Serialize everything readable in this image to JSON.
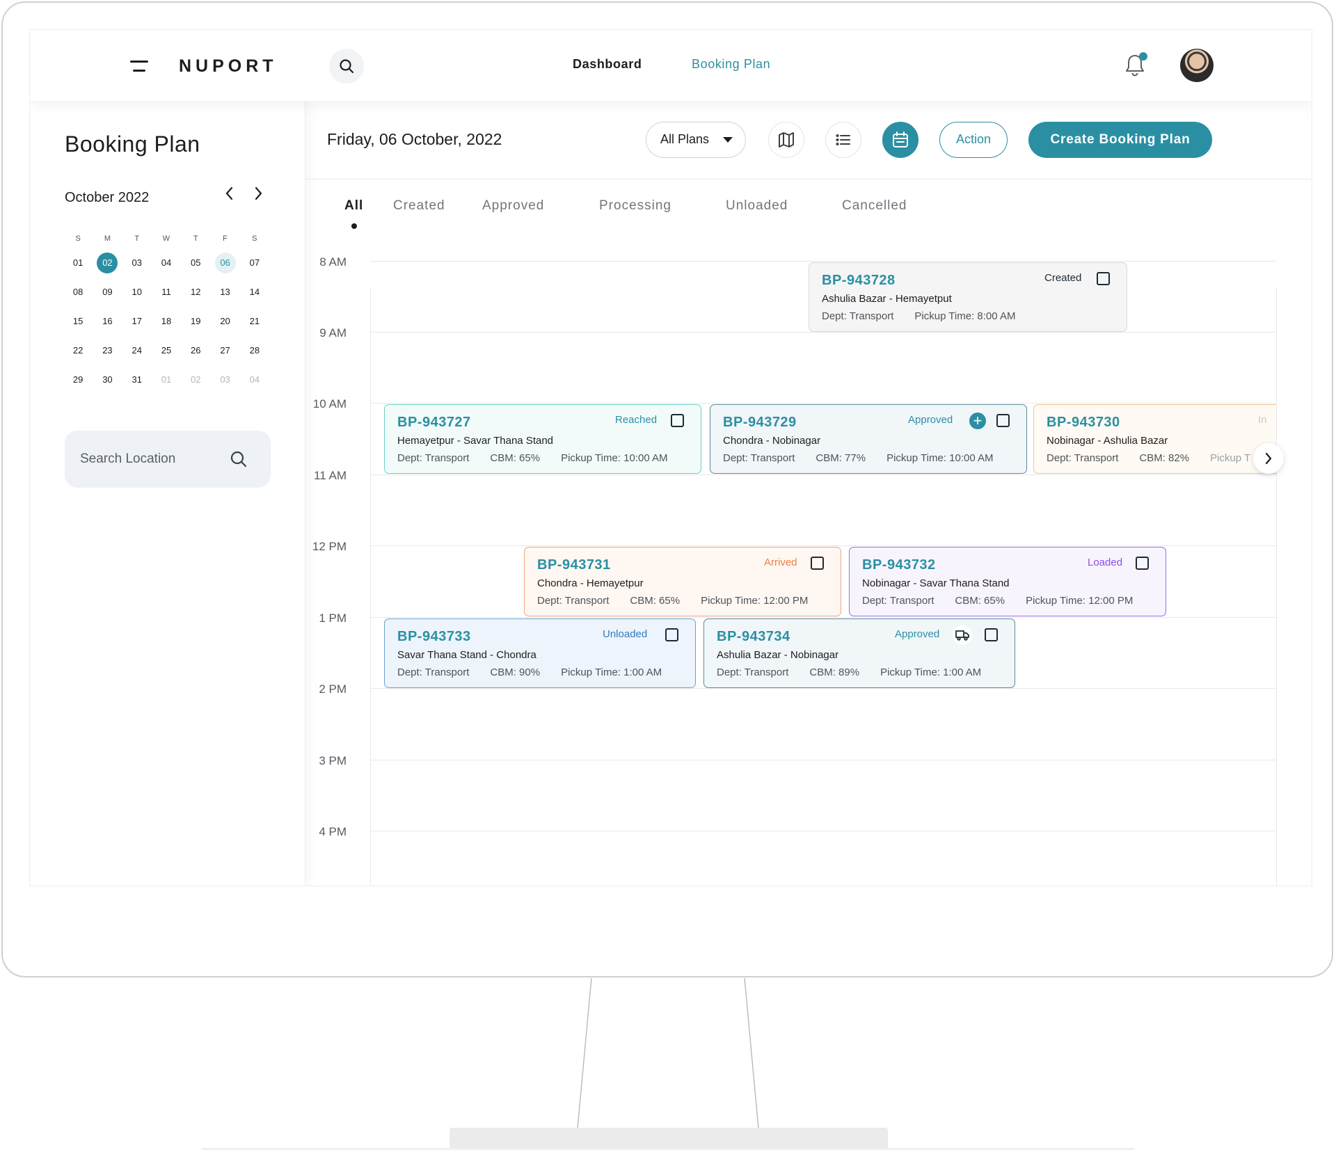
{
  "app": {
    "logo": "NUPORT"
  },
  "nav": {
    "dashboard": "Dashboard",
    "booking_plan": "Booking Plan"
  },
  "sidebar": {
    "title": "Booking Plan",
    "calendar": {
      "month": "October 2022",
      "weekdays": [
        "S",
        "M",
        "T",
        "W",
        "T",
        "F",
        "S"
      ],
      "weeks": [
        [
          "01",
          "02",
          "03",
          "04",
          "05",
          "06",
          "07"
        ],
        [
          "08",
          "09",
          "10",
          "11",
          "12",
          "13",
          "14"
        ],
        [
          "15",
          "16",
          "17",
          "18",
          "19",
          "20",
          "21"
        ],
        [
          "22",
          "23",
          "24",
          "25",
          "26",
          "27",
          "28"
        ],
        [
          "29",
          "30",
          "31",
          "01",
          "02",
          "03",
          "04"
        ]
      ],
      "selected_day": "02",
      "highlighted_day": "06"
    },
    "search_placeholder": "Search Location"
  },
  "toolbar": {
    "date": "Friday, 06 October, 2022",
    "plans_filter": "All Plans",
    "action_label": "Action",
    "create_label": "Create Booking Plan"
  },
  "tabs": [
    "All",
    "Created",
    "Approved",
    "Processing",
    "Unloaded",
    "Cancelled"
  ],
  "active_tab": "All",
  "hours": [
    "8 AM",
    "9 AM",
    "10 AM",
    "11 AM",
    "12 PM",
    "1 PM",
    "2 PM",
    "3 PM",
    "4 PM"
  ],
  "colors": {
    "accent": "#2b8fa3",
    "created": "#1d2a33",
    "reached": "#2b8fa3",
    "approved": "#2b8fa3",
    "arrived": "#ef7f45",
    "loaded": "#8a4de8",
    "unloaded": "#2f7bc2"
  },
  "cards": [
    {
      "id": "BP-943728",
      "status": "Created",
      "route": "Ashulia Bazar - Hemayetput",
      "dept": "Dept: Transport",
      "cbm": "",
      "pickup": "Pickup Time: 8:00 AM"
    },
    {
      "id": "BP-943727",
      "status": "Reached",
      "route": "Hemayetpur -  Savar Thana Stand",
      "dept": "Dept: Transport",
      "cbm": "CBM: 65%",
      "pickup": "Pickup Time: 10:00 AM"
    },
    {
      "id": "BP-943729",
      "status": "Approved",
      "route": "Chondra - Nobinagar",
      "dept": "Dept: Transport",
      "cbm": "CBM: 77%",
      "pickup": "Pickup Time: 10:00 AM"
    },
    {
      "id": "BP-943730",
      "status": "In",
      "route": "Nobinagar - Ashulia Bazar",
      "dept": "Dept: Transport",
      "cbm": "CBM: 82%",
      "pickup": "Pickup T"
    },
    {
      "id": "BP-943731",
      "status": "Arrived",
      "route": "Chondra - Hemayetpur",
      "dept": "Dept: Transport",
      "cbm": "CBM: 65%",
      "pickup": "Pickup Time: 12:00 PM"
    },
    {
      "id": "BP-943732",
      "status": "Loaded",
      "route": "Nobinagar - Savar Thana Stand",
      "dept": "Dept: Transport",
      "cbm": "CBM: 65%",
      "pickup": "Pickup Time: 12:00 PM"
    },
    {
      "id": "BP-943733",
      "status": "Unloaded",
      "route": "Savar Thana Stand - Chondra",
      "dept": "Dept: Transport",
      "cbm": "CBM: 90%",
      "pickup": "Pickup Time: 1:00 AM"
    },
    {
      "id": "BP-943734",
      "status": "Approved",
      "route": "Ashulia Bazar - Nobinagar",
      "dept": "Dept: Transport",
      "cbm": "CBM: 89%",
      "pickup": "Pickup Time: 1:00 AM"
    }
  ]
}
